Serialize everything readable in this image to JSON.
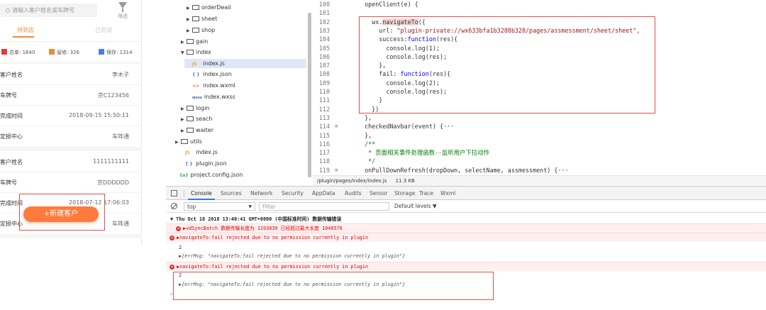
{
  "phone": {
    "search_placeholder": "请输入客户姓名或车牌号",
    "filter_label": "筛选",
    "tabs": [
      "待到店",
      "已完成"
    ],
    "stats": [
      {
        "label": "总单: 1640",
        "color": "#e23a3a"
      },
      {
        "label": "留修: 326",
        "color": "#f08a3a"
      },
      {
        "label": "保存: 1314",
        "color": "#4a7ef0"
      }
    ],
    "cards": [
      {
        "rows": [
          {
            "key": "客户姓名",
            "value": "李木子"
          },
          {
            "key": "车牌号",
            "value": "京C123456"
          },
          {
            "key": "完成时间",
            "value": "2018-09-15 15:50:11"
          },
          {
            "key": "定损中心",
            "value": "车阵通"
          }
        ]
      },
      {
        "rows": [
          {
            "key": "客户姓名",
            "value": "1111111111"
          },
          {
            "key": "车牌号",
            "value": "京DDDDDD"
          },
          {
            "key": "完成时间",
            "value": "2018-07-12 17:06:03"
          },
          {
            "key": "定损中心",
            "value": "车阵通"
          }
        ]
      }
    ],
    "fab_label": "+新建客户"
  },
  "tree": {
    "nodes": [
      {
        "label": "orderDeail",
        "kind": "folder",
        "arrow": "▶"
      },
      {
        "label": "sheet",
        "kind": "folder",
        "arrow": "▶"
      },
      {
        "label": "shop",
        "kind": "folder",
        "arrow": "▶"
      },
      {
        "label": "gain",
        "kind": "folder",
        "arrow": "▶"
      },
      {
        "label": "index",
        "kind": "folder",
        "arrow": "▼"
      },
      {
        "label": "index.js",
        "kind": "js",
        "icon": "JS"
      },
      {
        "label": "index.json",
        "kind": "json",
        "icon": "{ }"
      },
      {
        "label": "index.wxml",
        "kind": "wxml",
        "icon": "<>"
      },
      {
        "label": "index.wxss",
        "kind": "wxss",
        "icon": "wxss"
      },
      {
        "label": "login",
        "kind": "folder",
        "arrow": "▶"
      },
      {
        "label": "seach",
        "kind": "folder",
        "arrow": "▶"
      },
      {
        "label": "waiter",
        "kind": "folder",
        "arrow": "▶"
      },
      {
        "label": "utils",
        "kind": "folder",
        "arrow": "▶"
      },
      {
        "label": "index.js",
        "kind": "js",
        "icon": "JS"
      },
      {
        "label": "plugin.json",
        "kind": "json",
        "icon": "{ }"
      },
      {
        "label": "project.config.json",
        "kind": "cfg",
        "icon": "{o}"
      }
    ]
  },
  "editor": {
    "lines": [
      {
        "n": "100",
        "fold": "",
        "t": "  openClient(e) {"
      },
      {
        "n": "101",
        "fold": "",
        "t": ""
      },
      {
        "n": "102",
        "fold": "",
        "t": "    wx.navigateTo({"
      },
      {
        "n": "103",
        "fold": "",
        "t": "      url: \"plugin-private://wx633bfa1b3288b328/pages/assmessment/sheet/sheet\","
      },
      {
        "n": "104",
        "fold": "",
        "t": "      success:function(res){"
      },
      {
        "n": "105",
        "fold": "",
        "t": "        console.log(1);"
      },
      {
        "n": "106",
        "fold": "",
        "t": "        console.log(res);"
      },
      {
        "n": "107",
        "fold": "",
        "t": "      },"
      },
      {
        "n": "108",
        "fold": "",
        "t": "      fail: function(res){"
      },
      {
        "n": "109",
        "fold": "",
        "t": "        console.log(2);"
      },
      {
        "n": "110",
        "fold": "",
        "t": "        console.log(res);"
      },
      {
        "n": "111",
        "fold": "",
        "t": "      }"
      },
      {
        "n": "112",
        "fold": "",
        "t": "    })"
      },
      {
        "n": "113",
        "fold": "",
        "t": "  },"
      },
      {
        "n": "114",
        "fold": "⊞",
        "t": "  checkedNavbar(event) {···"
      },
      {
        "n": "115",
        "fold": "",
        "t": "  },"
      },
      {
        "n": "116",
        "fold": "",
        "t": "  /**"
      },
      {
        "n": "117",
        "fold": "",
        "t": "   * 页面相关事件处理函数--监听用户下拉动作"
      },
      {
        "n": "118",
        "fold": "",
        "t": "   */"
      },
      {
        "n": "119",
        "fold": "⊞",
        "t": "  onPullDownRefresh(dropDown, selectName, assmessment) {···"
      }
    ],
    "status_path": "/plugin/pages/index/index.js",
    "status_size": "11.3 KB"
  },
  "devtools": {
    "tabs": [
      "Console",
      "Sources",
      "Network",
      "Security",
      "AppData",
      "Audits",
      "Sensor",
      "Storage",
      "Trace",
      "Wxml"
    ],
    "context": "top",
    "filter_placeholder": "Filter",
    "levels": "Default levels ▼",
    "console": [
      {
        "type": "group",
        "text": "▼ Thu Oct 18 2018 13:40:41 GMT+0800 (中国标准时间) 数据传输错误"
      },
      {
        "type": "err",
        "text": "▶vdSyncBatch 数据传输长度为 1193839 已经超过最大长度 1048576",
        "indent": true
      },
      {
        "type": "err",
        "text": "▶navigateTo:fail rejected due to no permission currently in plugin"
      },
      {
        "type": "num",
        "text": "2"
      },
      {
        "type": "obj",
        "text": "▶{errMsg: \"navigateTo:fail rejected due to no permission currently in plugin\"}"
      },
      {
        "type": "err",
        "text": "▶navigateTo:fail rejected due to no permission currently in plugin"
      },
      {
        "type": "num",
        "text": "2"
      },
      {
        "type": "obj",
        "text": "▶{errMsg: \"navigateTo:fail rejected due to no permission currently in plugin\"}"
      }
    ],
    "prompt": "›"
  }
}
